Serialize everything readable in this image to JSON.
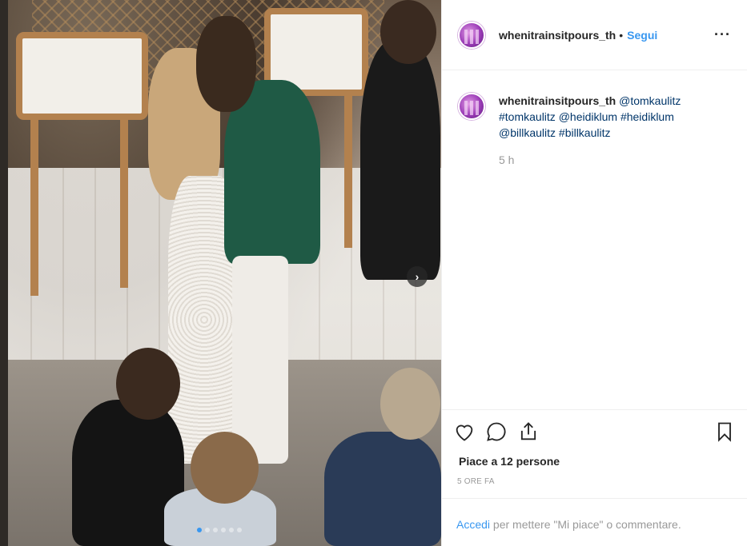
{
  "post": {
    "username": "whenitrainsitpours_th",
    "separator": "•",
    "follow_label": "Segui",
    "more_label": "···",
    "caption_user": "whenitrainsitpours_th",
    "caption_tags": [
      "@tomkaulitz",
      "#tomkaulitz",
      "@heidiklum",
      "#heidiklum",
      "@billkaulitz",
      "#billkaulitz"
    ],
    "comment_time": "5 h",
    "likes_text": "Piace a 12 persone",
    "posted_ago": "5 ORE FA",
    "login_link": "Accedi",
    "login_text": " per mettere \"Mi piace\" o commentare.",
    "carousel": {
      "dots": 6,
      "active_index": 0
    }
  },
  "icons": {
    "like": "heart-icon",
    "comment": "comment-icon",
    "share": "share-icon",
    "save": "bookmark-icon",
    "next": "chevron-right-icon"
  },
  "colors": {
    "link": "#3897f0",
    "text": "#262626",
    "muted": "#999999",
    "tag": "#003569",
    "border": "#efefef"
  }
}
